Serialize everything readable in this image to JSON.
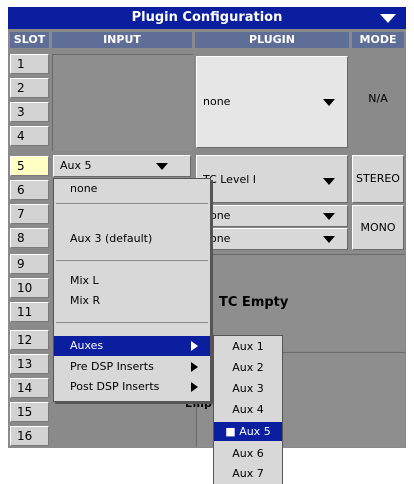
{
  "window": {
    "title": "Plugin Configuration",
    "title_menu_icon": "down-triangle-icon"
  },
  "columns": {
    "slot": "SLOT",
    "input": "INPUT",
    "plugin": "PLUGIN",
    "mode": "MODE"
  },
  "slots": [
    "1",
    "2",
    "3",
    "4",
    "5",
    "6",
    "7",
    "8",
    "9",
    "10",
    "11",
    "12",
    "13",
    "14",
    "15",
    "16"
  ],
  "selected_slot": "5",
  "rows": {
    "group1": {
      "plugin": "none",
      "mode": "N/A"
    },
    "slot5": {
      "input": "Aux 5",
      "plugin": "TC Level I",
      "mode": "STEREO"
    },
    "slot7": {
      "plugin": "none"
    },
    "slot8": {
      "plugin": "none"
    },
    "slot78_mode": "MONO",
    "group9": {
      "plugin": "TC Empty"
    },
    "slot14_partial": "Emp"
  },
  "input_menu": {
    "items": [
      "none",
      "Aux 3 (default)",
      "Mix L",
      "Mix R",
      "Auxes",
      "Pre DSP Inserts",
      "Post DSP Inserts"
    ],
    "highlighted": "Auxes"
  },
  "aux_submenu": {
    "items": [
      "Aux 1",
      "Aux 2",
      "Aux 3",
      "Aux 4",
      "Aux 5",
      "Aux 6",
      "Aux 7"
    ],
    "checked": "Aux 5",
    "check_mark": "■"
  },
  "colors": {
    "title_bar": "#0b1ea0",
    "selected_slot_bg": "#ffffc4",
    "panel_gray": "#8e8e8e",
    "highlight": "#0b1ea0"
  }
}
